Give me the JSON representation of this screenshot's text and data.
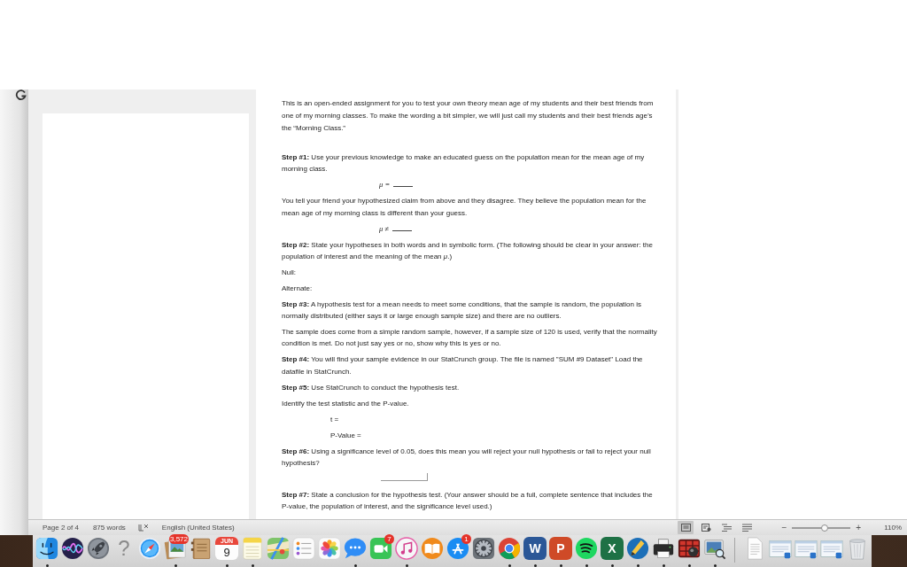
{
  "document": {
    "paragraphs": [
      {
        "kind": "intro",
        "text": "This is an open-ended assignment for you to test your own theory mean age of my students and their best friends from one of my morning classes. To make the wording a bit simpler, we will just call my students and their best friends age’s the “Morning Class.”"
      },
      {
        "kind": "text",
        "text": "**Step #1:** Use your previous knowledge to make an educated guess on the population mean for the mean age of my morning class."
      },
      {
        "kind": "formula",
        "text": "μ ="
      },
      {
        "kind": "text",
        "text": "You tell your friend your hypothesized claim from above and they disagree. They believe the population mean for the mean age of my morning class is different than your guess."
      },
      {
        "kind": "formula",
        "text": "μ ≠"
      },
      {
        "kind": "text",
        "text": "**Step #2:** State your hypotheses in both words and in symbolic form. (The following should be clear in your answer: the population of interest and the meaning of the mean *μ*.)"
      },
      {
        "kind": "text",
        "text": "Null:"
      },
      {
        "kind": "text",
        "text": "Alternate:"
      },
      {
        "kind": "text",
        "text": "**Step #3:** A hypothesis test for a mean needs to meet some conditions, that the sample is random, the population is normally distributed (either says it or large enough sample size) and there are no outliers."
      },
      {
        "kind": "text",
        "text": "The sample does come from a simple random sample, however, if a sample size of 120 is used, verify that the normality condition is met. Do not just say yes or no, show why this is yes or no."
      },
      {
        "kind": "text",
        "text": "**Step #4:** You will find your sample evidence in our StatCrunch group. The file is named \"SUM #9 Dataset\" Load the datafile in StatCrunch."
      },
      {
        "kind": "text",
        "text": "**Step #5:** Use StatCrunch to conduct the hypothesis test."
      },
      {
        "kind": "text",
        "text": "Identify the test statistic and the P-value."
      },
      {
        "kind": "indented",
        "text": "t ="
      },
      {
        "kind": "indented",
        "text": "P-Value ="
      },
      {
        "kind": "text",
        "text": "**Step #6:** Using a significance level of 0.05, does this mean you will reject your null hypothesis or fail to reject your null hypothesis?"
      },
      {
        "kind": "answer_box"
      },
      {
        "kind": "text",
        "text": "**Step #7:** State a conclusion for the hypothesis test. (Your answer should be a full, complete sentence that includes the P-value, the population of interest, and the significance level used.)"
      }
    ]
  },
  "status_bar": {
    "page": "Page 2 of 4",
    "words": "875 words",
    "language": "English (United States)",
    "views": [
      {
        "kind": "print",
        "selected": true
      },
      {
        "kind": "web",
        "selected": false
      },
      {
        "kind": "outline",
        "selected": false
      },
      {
        "kind": "draft",
        "selected": false
      }
    ],
    "zoom": {
      "out_label": "−",
      "in_label": "+",
      "level": 0.55,
      "percent": "110%"
    }
  },
  "dock": {
    "items": [
      {
        "kind": "finder",
        "running": true
      },
      {
        "kind": "siri",
        "running": false
      },
      {
        "kind": "rocket",
        "running": false
      },
      {
        "kind": "question",
        "glyph": "?",
        "running": false
      },
      {
        "kind": "safari",
        "running": false
      },
      {
        "kind": "preview",
        "badge": "3,572",
        "running": true
      },
      {
        "kind": "addressbook",
        "running": false
      },
      {
        "kind": "calendar",
        "month": "JUN",
        "glyph": "9",
        "running": true
      },
      {
        "kind": "notes",
        "running": true
      },
      {
        "kind": "maps",
        "running": false
      },
      {
        "kind": "reminders",
        "running": false
      },
      {
        "kind": "photos",
        "running": false
      },
      {
        "kind": "messages",
        "running": true
      },
      {
        "kind": "facetime",
        "badge": "7",
        "running": false
      },
      {
        "kind": "music",
        "running": true
      },
      {
        "kind": "books",
        "running": false
      },
      {
        "kind": "appstore",
        "badge": "1",
        "running": false
      },
      {
        "kind": "settings",
        "running": false
      },
      {
        "kind": "chrome",
        "running": true
      },
      {
        "kind": "word",
        "glyph": "W",
        "running": true
      },
      {
        "kind": "powerpoint",
        "glyph": "P",
        "running": true
      },
      {
        "kind": "spotify",
        "running": true
      },
      {
        "kind": "excel",
        "glyph": "X",
        "running": true
      },
      {
        "kind": "pencil",
        "running": true
      },
      {
        "kind": "printer",
        "running": true
      },
      {
        "kind": "grid",
        "running": true
      },
      {
        "kind": "viewer",
        "running": true
      },
      {
        "kind": "separator"
      },
      {
        "kind": "document",
        "running": false
      },
      {
        "kind": "window",
        "running": false
      },
      {
        "kind": "window",
        "running": false
      },
      {
        "kind": "window",
        "running": false
      },
      {
        "kind": "trash",
        "running": false
      }
    ]
  }
}
